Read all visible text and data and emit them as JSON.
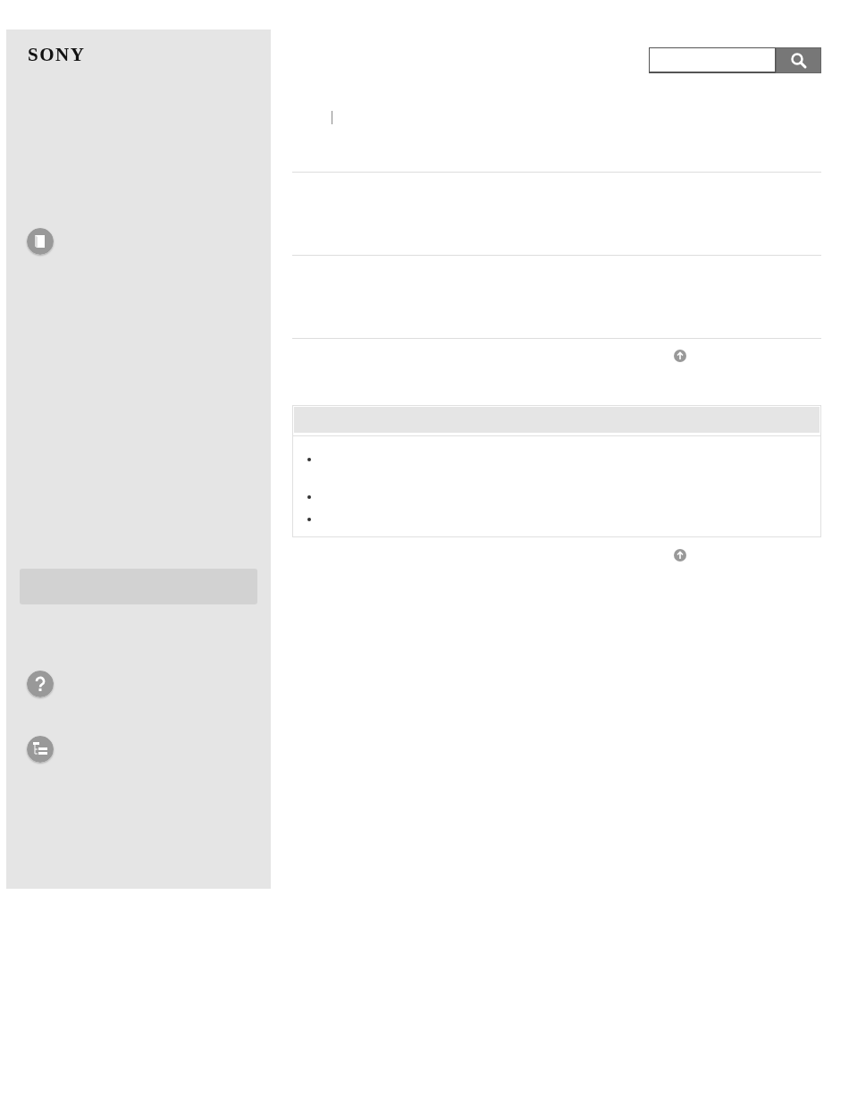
{
  "sidebar": {
    "logo": "SONY"
  }
}
